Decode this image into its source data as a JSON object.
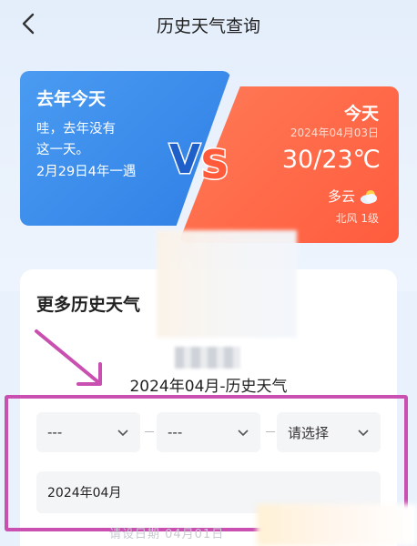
{
  "header": {
    "title": "历史天气查询"
  },
  "last_year": {
    "title": "去年今天",
    "lines": [
      "哇，去年没有",
      "这一天。",
      "2月29日4年一遇"
    ]
  },
  "today": {
    "title": "今天",
    "date": "2024年04月03日",
    "temp": "30/23℃",
    "condition": "多云",
    "wind": "北风 1级"
  },
  "vs_label": "VS",
  "history": {
    "title": "更多历史天气",
    "month_title": "2024年04月-历史天气",
    "select1": "---",
    "select2": "---",
    "select3": "请选择",
    "date_value": "2024年04月",
    "bottom_faint": "请设日期 04月01日"
  },
  "colors": {
    "blue_card": "#3a8cec",
    "orange_card": "#ff6a48",
    "highlight": "#c94fb0"
  }
}
